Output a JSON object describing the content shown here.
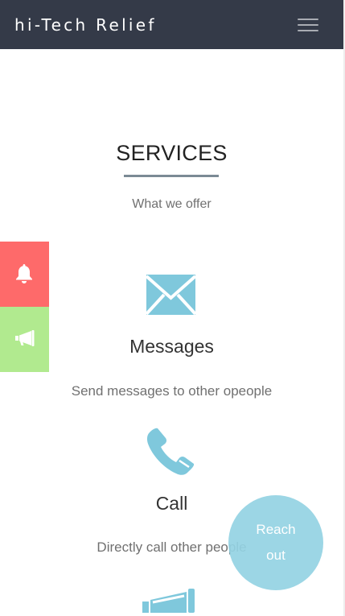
{
  "navbar": {
    "brand": "hi-Tech Relief",
    "menu_icon": "hamburger-menu-icon"
  },
  "services": {
    "title": "SERVICES",
    "subtitle": "What we offer",
    "items": [
      {
        "icon": "envelope-icon",
        "title": "Messages",
        "description": "Send messages to other opeople"
      },
      {
        "icon": "phone-icon",
        "title": "Call",
        "description": "Directly call other people"
      },
      {
        "icon": "megaphone-icon"
      }
    ]
  },
  "side_buttons": [
    {
      "icon": "bell-icon",
      "color": "#fe6a6a"
    },
    {
      "icon": "megaphone-icon",
      "color": "#b1ea8f"
    }
  ],
  "reach_out": {
    "label": "Reach out"
  },
  "colors": {
    "navbar_bg": "#343a48",
    "accent_blue": "#7fc8dc",
    "underline": "#7b8a95"
  }
}
